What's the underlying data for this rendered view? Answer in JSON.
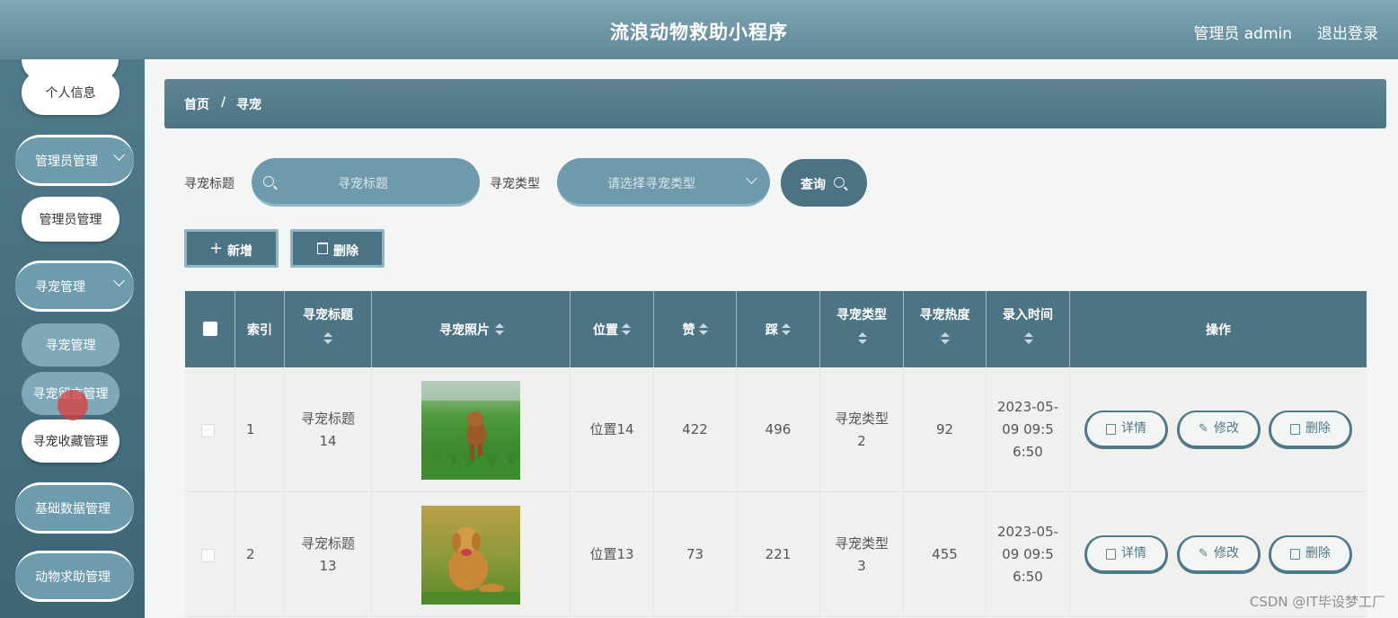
{
  "header": {
    "title": "流浪动物救助小程序",
    "user": "管理员 admin",
    "logout": "退出登录"
  },
  "sidebar": {
    "personal_info": "个人信息",
    "admin_group": "管理员管理",
    "admin_item": "管理员管理",
    "pet_group": "寻宠管理",
    "pet_items": [
      "寻宠管理",
      "寻宠留言管理",
      "寻宠收藏管理"
    ],
    "base_group": "基础数据管理",
    "rescue_group": "动物求助管理"
  },
  "breadcrumb": {
    "home": "首页",
    "sep": "/",
    "current": "寻宠"
  },
  "search": {
    "title_label": "寻宠标题",
    "title_placeholder": "寻宠标题",
    "type_label": "寻宠类型",
    "type_placeholder": "请选择寻宠类型",
    "query_button": "查询"
  },
  "actions": {
    "add": "新增",
    "delete": "删除"
  },
  "table": {
    "columns": [
      "索引",
      "寻宠标题",
      "寻宠照片",
      "位置",
      "赞",
      "踩",
      "寻宠类型",
      "寻宠热度",
      "录入时间",
      "操作"
    ],
    "rows": [
      {
        "index": "1",
        "title": "寻宠标题14",
        "photo": "poodle-on-grass",
        "location": "位置14",
        "likes": "422",
        "dislikes": "496",
        "type": "寻宠类型2",
        "heat": "92",
        "time": "2023-05-09 09:56:50"
      },
      {
        "index": "2",
        "title": "寻宠标题13",
        "photo": "golden-retriever-on-grass",
        "location": "位置13",
        "likes": "73",
        "dislikes": "221",
        "type": "寻宠类型3",
        "heat": "455",
        "time": "2023-05-09 09:56:50"
      }
    ],
    "row_buttons": {
      "detail": "详情",
      "edit": "修改",
      "delete": "删除"
    }
  },
  "watermark": "CSDN @IT毕设梦工厂",
  "colors": {
    "header": "#6f98a8",
    "sidebar": "#46707f",
    "accent": "#4b7383",
    "light_accent": "#8fb7c5"
  }
}
